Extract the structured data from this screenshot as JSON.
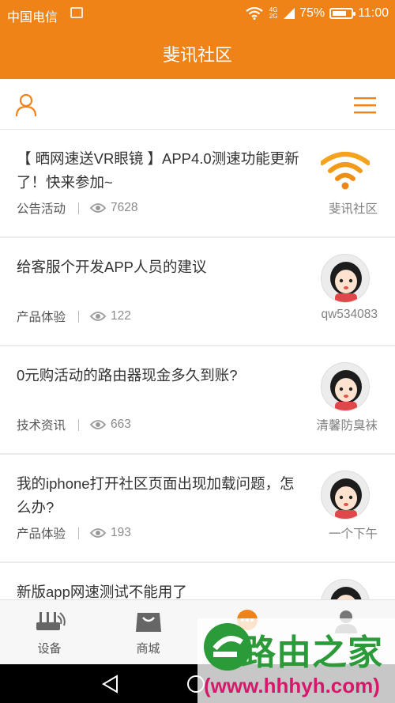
{
  "status_bar": {
    "carrier": "中国电信",
    "network": "4G 2G",
    "battery": "75%",
    "battery_level": 0.75,
    "time": "11:00"
  },
  "header": {
    "title": "斐讯社区"
  },
  "toolbar": {
    "left_icon": "user-icon",
    "right_icon": "menu-icon"
  },
  "posts": [
    {
      "title": "【 晒网速送VR眼镜 】APP4.0测速功能更新了！快来参加~",
      "category": "公告活动",
      "views": "7628",
      "author": "斐讯社区",
      "avatar": "wifi-logo"
    },
    {
      "title": "给客服个开发APP人员的建议",
      "category": "产品体验",
      "views": "122",
      "author": "qw534083",
      "avatar": "girl-avatar"
    },
    {
      "title": "0元购活动的路由器现金多久到账?",
      "category": "技术资讯",
      "views": "663",
      "author": "清馨防臭袜",
      "avatar": "girl-avatar"
    },
    {
      "title": "我的iphone打开社区页面出现加载问题，怎么办?",
      "category": "产品体验",
      "views": "193",
      "author": "一个下午",
      "avatar": "girl-avatar"
    },
    {
      "title": "新版app网速测试不能用了",
      "category": "",
      "views": "",
      "author": "",
      "avatar": "girl-avatar"
    }
  ],
  "tabs": [
    {
      "label": "设备",
      "icon": "router-icon"
    },
    {
      "label": "商城",
      "icon": "shopping-bag-icon"
    },
    {
      "label": "",
      "icon": "community-icon"
    },
    {
      "label": "",
      "icon": "profile-icon"
    }
  ],
  "watermark": {
    "text": "路由之家",
    "url": "(www.hhhyh.com)"
  },
  "colors": {
    "accent": "#f08318",
    "watermark_green": "#2b9b3a",
    "watermark_pink": "#d6186a"
  }
}
